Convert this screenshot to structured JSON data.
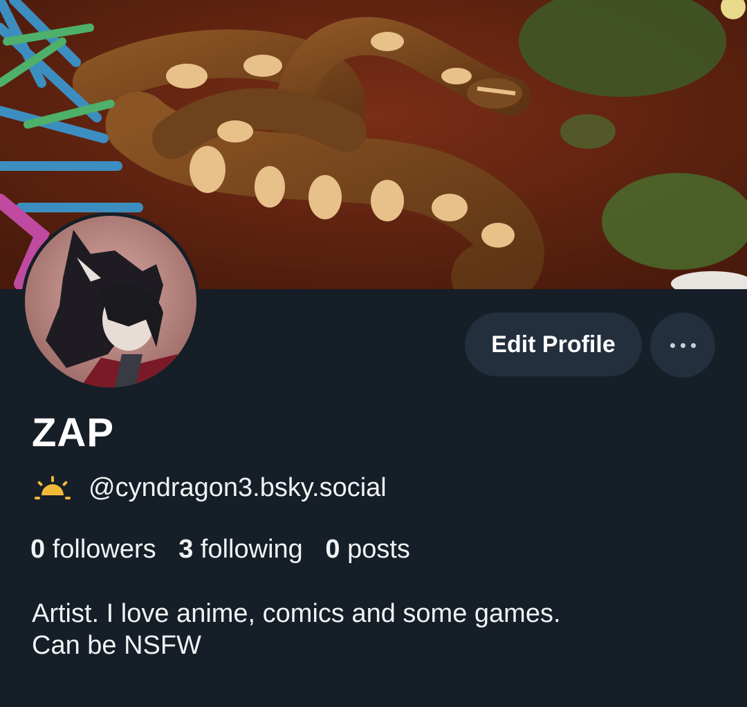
{
  "profile": {
    "display_name": "ZAP",
    "handle_icon": "sunrise-icon",
    "handle": "@cyndragon3.bsky.social",
    "bio_line1": "Artist. I love anime, comics and some games.",
    "bio_line2": "Can be NSFW"
  },
  "stats": {
    "followers_count": "0",
    "followers_label": "followers",
    "following_count": "3",
    "following_label": "following",
    "posts_count": "0",
    "posts_label": "posts"
  },
  "actions": {
    "edit_label": "Edit Profile",
    "more_icon": "ellipsis-icon"
  },
  "colors": {
    "background": "#161e27",
    "button_bg": "#232f3d",
    "sun_accent": "#f0b93a"
  }
}
